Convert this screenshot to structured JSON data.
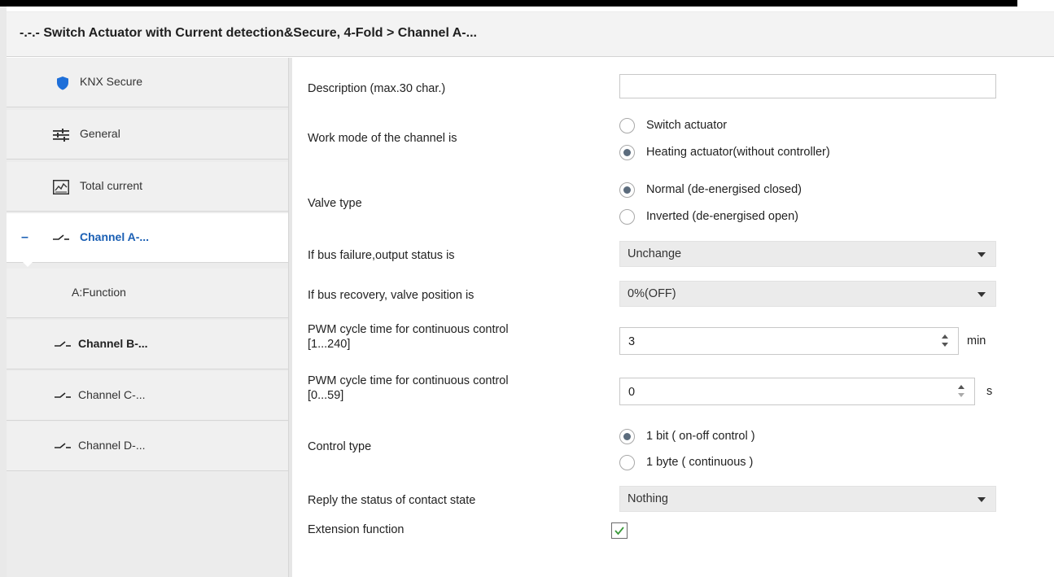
{
  "header": {
    "title": "-.-.- Switch Actuator with Current detection&Secure, 4-Fold > Channel A-..."
  },
  "sidebar": {
    "items": [
      {
        "label": "KNX Secure",
        "icon": "shield-icon"
      },
      {
        "label": "General",
        "icon": "sliders-icon"
      },
      {
        "label": "Total current",
        "icon": "chart-icon"
      },
      {
        "label": "Channel A-...",
        "icon": "switch-icon",
        "collapse": "–"
      },
      {
        "label": "A:Function"
      },
      {
        "label": "Channel B-...",
        "icon": "switch-icon"
      },
      {
        "label": "Channel C-...",
        "icon": "switch-icon"
      },
      {
        "label": "Channel D-...",
        "icon": "switch-icon"
      }
    ]
  },
  "params": {
    "description": {
      "label": "Description (max.30 char.)",
      "value": ""
    },
    "work_mode": {
      "label": "Work mode of the channel is",
      "options": [
        "Switch actuator",
        "Heating actuator(without controller)"
      ],
      "selected": "Heating actuator(without controller)"
    },
    "valve_type": {
      "label": "Valve type",
      "options": [
        "Normal (de-energised closed)",
        "Inverted (de-energised open)"
      ],
      "selected": "Normal (de-energised closed)"
    },
    "bus_failure": {
      "label": "If bus failure,output status is",
      "value": "Unchange"
    },
    "bus_recovery": {
      "label": "If bus recovery, valve position is",
      "value": "0%(OFF)"
    },
    "pwm_min": {
      "label_line1": "PWM cycle time for continuous control",
      "label_line2": "[1...240]",
      "value": "3",
      "unit": "min"
    },
    "pwm_sec": {
      "label_line1": "PWM cycle time for continuous control",
      "label_line2": "[0...59]",
      "value": "0",
      "unit": "s"
    },
    "control_type": {
      "label": "Control type",
      "options": [
        "1 bit ( on-off control )",
        "1 byte ( continuous )"
      ],
      "selected": "1 bit ( on-off control )"
    },
    "reply_status": {
      "label": "Reply the status of contact state",
      "value": "Nothing"
    },
    "extension": {
      "label": "Extension function",
      "checked": true
    }
  },
  "colors": {
    "accent": "#1a5fb4",
    "shield": "#1e6fd9",
    "check": "#3a9a3a"
  }
}
